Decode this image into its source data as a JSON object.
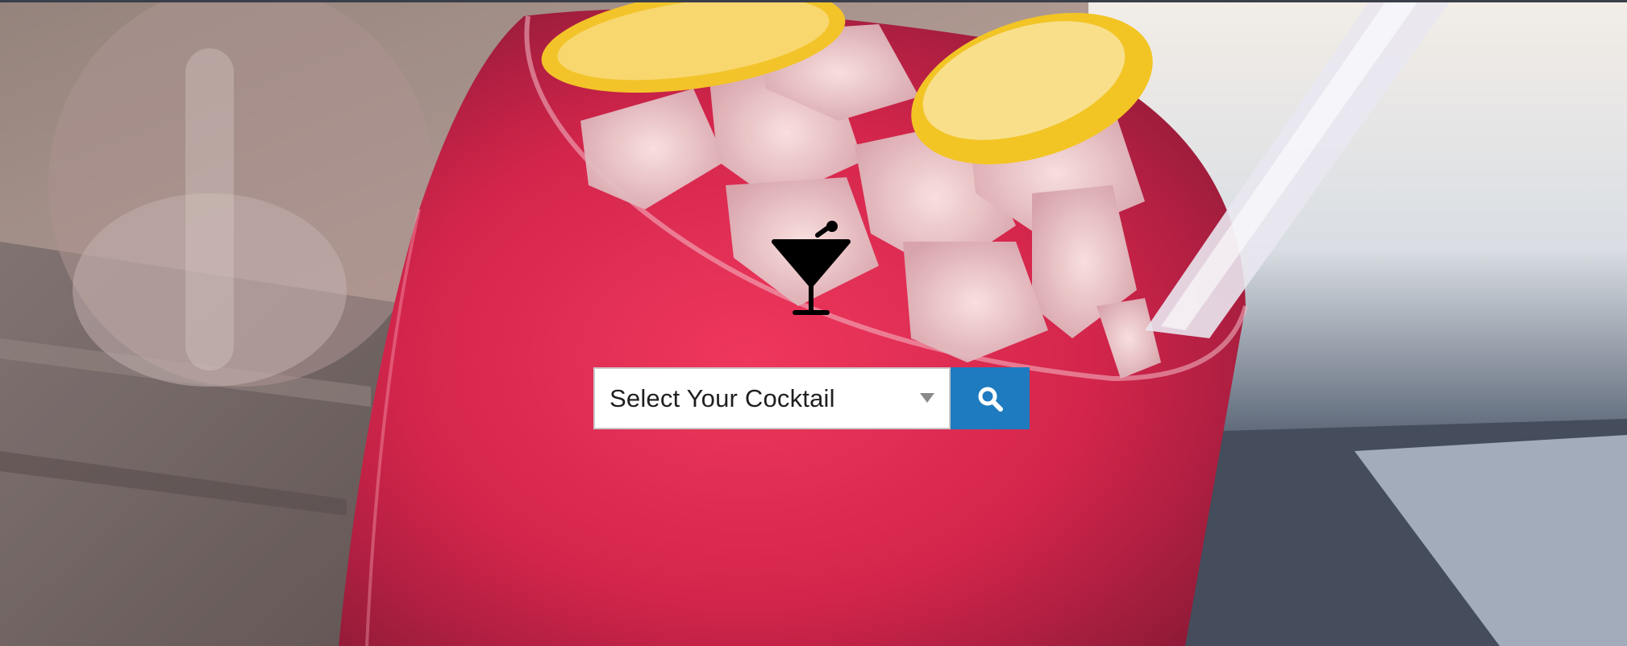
{
  "search": {
    "selected_value": "Select Your Cocktail",
    "select_aria": "Select Your Cocktail",
    "button_icon": "search-icon",
    "button_color": "#1f7bbf"
  },
  "brand": {
    "logo_icon": "cocktail-glass-icon"
  },
  "background": {
    "drink_color": "#d91f45",
    "garnish": "lemon-slice"
  }
}
